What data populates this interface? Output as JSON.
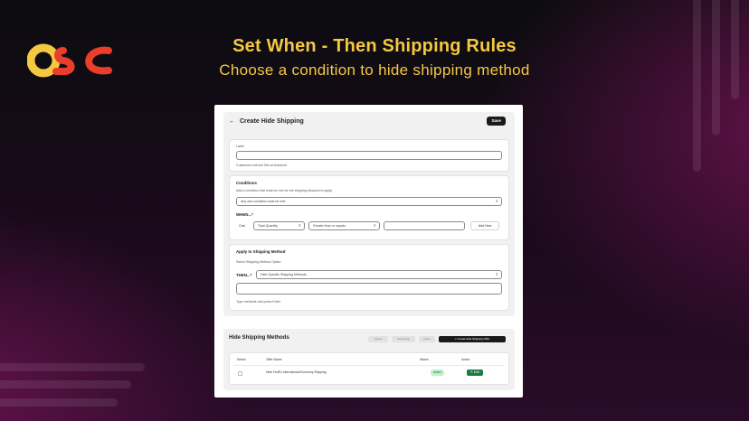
{
  "brand": {
    "logo_text": "OSC",
    "colors": {
      "yellow": "#f5c842",
      "red": "#e63323"
    }
  },
  "hero": {
    "title": "Set When - Then Shipping Rules",
    "subtitle": "Choose a condition to hide shipping method"
  },
  "app": {
    "page_title": "Create Hide Shipping",
    "back_icon": "arrow-left-icon",
    "save_label": "Save",
    "label_card": {
      "label": "Label",
      "value": "",
      "help": "Customers will see this at checkout"
    },
    "conditions_card": {
      "title": "Conditions",
      "description": "Add a condition that must be met for the shipping discount to apply.",
      "match_select": "Any one condition must be met",
      "when_label": "WHEN...*",
      "row": {
        "subject": "Cart",
        "field": "Total Quantity",
        "operator": "Greater than or equals",
        "value": "",
        "add_new": "Add New"
      }
    },
    "apply_card": {
      "title": "Apply to Shipping Method",
      "subtitle": "Select Shipping Method Option",
      "then_label": "THEN...*",
      "then_select": "Hide Specific Shipping Methods",
      "methods_value": "",
      "help": "Type methods and press Enter"
    },
    "list": {
      "title": "Hide Shipping Methods",
      "buttons": [
        "Delete",
        "Deactivate",
        "Active"
      ],
      "create_label": "+ Create Hide Shipping Offer",
      "columns": [
        "Select",
        "Offer Name",
        "Status",
        "Action"
      ],
      "rows": [
        {
          "name": "Hide FedEx International Economy Shipping",
          "status": "Active",
          "action": "Edit"
        }
      ]
    }
  }
}
